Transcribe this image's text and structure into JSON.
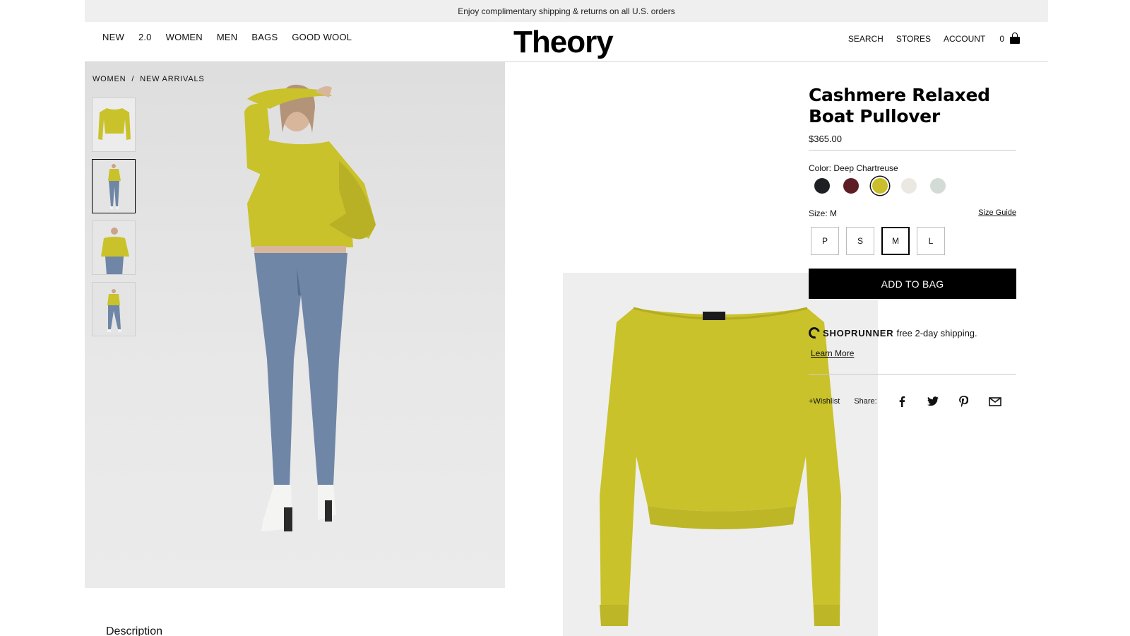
{
  "promo": {
    "text": "Enjoy complimentary shipping & returns on all U.S. orders"
  },
  "header": {
    "logo": "Theory",
    "nav_left": [
      "NEW",
      "2.0",
      "WOMEN",
      "MEN",
      "BAGS",
      "GOOD WOOL"
    ],
    "nav_right": {
      "search": "SEARCH",
      "stores": "STORES",
      "account": "ACCOUNT",
      "bag_count": "0"
    }
  },
  "breadcrumb": {
    "level1": "WOMEN",
    "separator": "/",
    "level2": "NEW ARRIVALS"
  },
  "product": {
    "title": "Cashmere Relaxed Boat Pullover",
    "price": "$365.00",
    "color_label": "Color: Deep Chartreuse",
    "swatches": [
      {
        "name": "black",
        "hex": "#1f2024"
      },
      {
        "name": "burgundy",
        "hex": "#5e1d24"
      },
      {
        "name": "deep-chartreuse",
        "hex": "#c8bf2a"
      },
      {
        "name": "ivory",
        "hex": "#ebe8e1"
      },
      {
        "name": "sage",
        "hex": "#d3dbd6"
      }
    ],
    "selected_swatch": "deep-chartreuse",
    "size_label": "Size: M",
    "size_guide": "Size Guide",
    "sizes": [
      "P",
      "S",
      "M",
      "L"
    ],
    "selected_size": "M",
    "add_to_bag": "ADD TO BAG",
    "shoprunner_brand": "SHOPRUNNER",
    "shoprunner_text": "free 2-day shipping.",
    "learn_more": "Learn More",
    "wishlist": "+Wishlist",
    "share_label": "Share:"
  },
  "description_heading": "Description",
  "colors": {
    "sweater": "#c9c22a",
    "denim": "#6f86a6"
  }
}
